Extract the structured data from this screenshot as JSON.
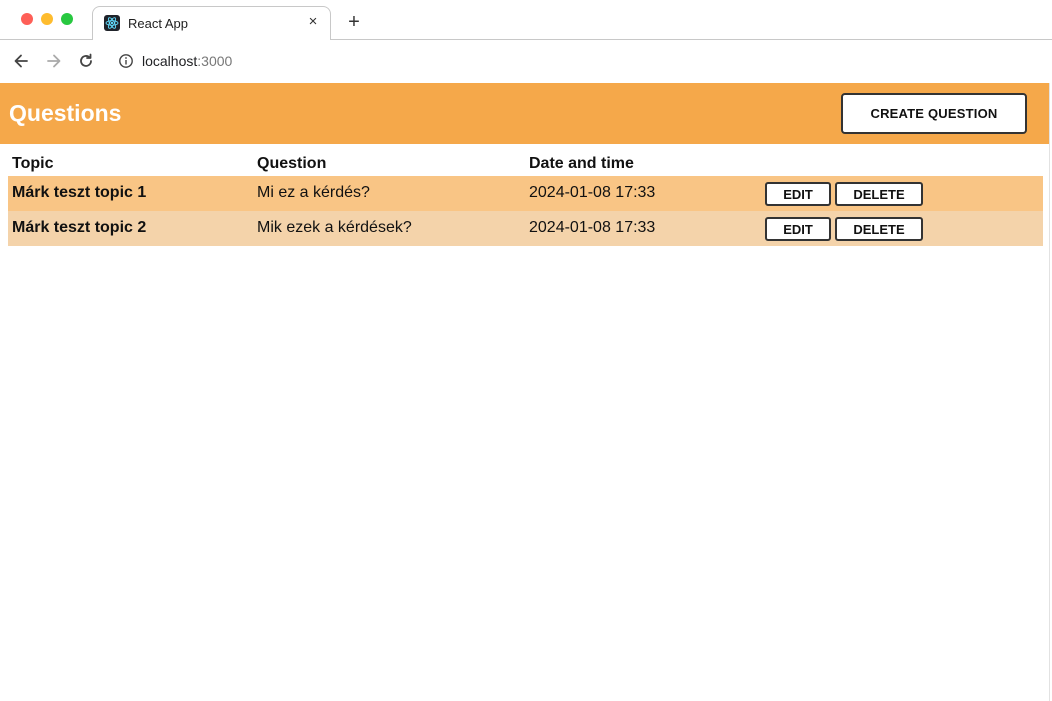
{
  "browser": {
    "tab_title": "React App",
    "tab_close": "×",
    "new_tab": "+",
    "url_host": "localhost",
    "url_port": ":3000"
  },
  "header": {
    "title": "Questions",
    "create_label": "CREATE QUESTION",
    "color": "#f5a84a"
  },
  "table": {
    "columns": [
      "Topic",
      "Question",
      "Date and time"
    ],
    "rows": [
      {
        "topic": "Márk teszt topic 1",
        "question": "Mi ez a kérdés?",
        "datetime": "2024-01-08 17:33",
        "edit": "EDIT",
        "delete": "DELETE",
        "color": "#f9c585"
      },
      {
        "topic": "Márk teszt topic 2",
        "question": "Mik ezek a kérdések?",
        "datetime": "2024-01-08 17:33",
        "edit": "EDIT",
        "delete": "DELETE",
        "color": "#f4d3aa"
      }
    ]
  },
  "icons": [
    "back-icon",
    "forward-icon",
    "reload-icon",
    "info-icon",
    "react-favicon-icon",
    "close-icon",
    "plus-icon"
  ]
}
